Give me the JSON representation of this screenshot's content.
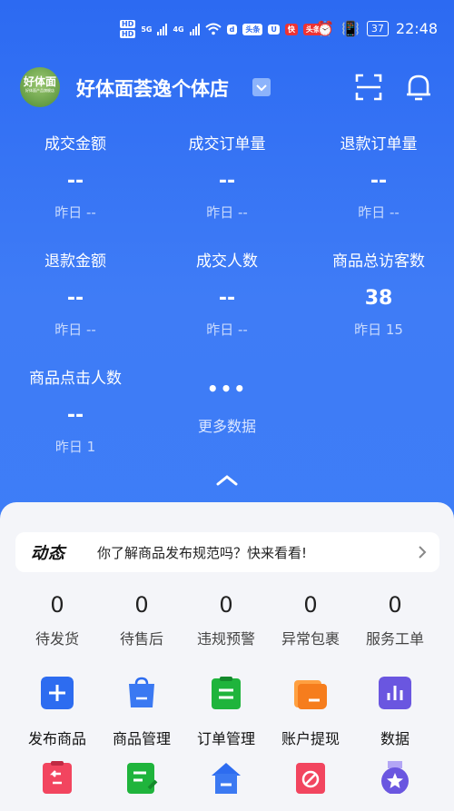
{
  "status_bar": {
    "hd1": "HD",
    "hd2": "HD",
    "net1": "5G",
    "net2": "4G",
    "chip1": "头条",
    "chip2": "头条",
    "battery": "37",
    "time": "22:48"
  },
  "header": {
    "avatar_text": "好体面",
    "avatar_sub": "好体面产品旗舰店",
    "shop_name": "好体面荟逸个体店"
  },
  "stats": [
    {
      "label": "成交金额",
      "value": "--",
      "yesterday": "昨日 --"
    },
    {
      "label": "成交订单量",
      "value": "--",
      "yesterday": "昨日 --"
    },
    {
      "label": "退款订单量",
      "value": "--",
      "yesterday": "昨日 --"
    },
    {
      "label": "退款金额",
      "value": "--",
      "yesterday": "昨日 --"
    },
    {
      "label": "成交人数",
      "value": "--",
      "yesterday": "昨日 --"
    },
    {
      "label": "商品总访客数",
      "value": "38",
      "yesterday": "昨日 15"
    },
    {
      "label": "商品点击人数",
      "value": "--",
      "yesterday": "昨日 1"
    }
  ],
  "more": {
    "dots": "•••",
    "label": "更多数据"
  },
  "notice": {
    "tag": "动态",
    "text": "你了解商品发布规范吗？快来看看!"
  },
  "counters": [
    {
      "value": "0",
      "label": "待发货"
    },
    {
      "value": "0",
      "label": "待售后"
    },
    {
      "value": "0",
      "label": "违规预警"
    },
    {
      "value": "0",
      "label": "异常包裹"
    },
    {
      "value": "0",
      "label": "服务工单"
    }
  ],
  "tools": [
    {
      "label": "发布商品",
      "icon": "plus-icon",
      "color": "#2d6cf0"
    },
    {
      "label": "商品管理",
      "icon": "shopping-bag-icon",
      "color": "#2d6cf0"
    },
    {
      "label": "订单管理",
      "icon": "clipboard-icon",
      "color": "#1fb43c"
    },
    {
      "label": "账户提现",
      "icon": "wallet-icon",
      "color": "#f67d1d"
    },
    {
      "label": "数据",
      "icon": "bar-chart-icon",
      "color": "#6a56e0"
    }
  ],
  "tools_row2": [
    {
      "icon": "return-icon",
      "color": "#f2455f"
    },
    {
      "icon": "edit-note-icon",
      "color": "#1fb43c"
    },
    {
      "icon": "store-icon",
      "color": "#2d6cf0"
    },
    {
      "icon": "block-icon",
      "color": "#f2455f"
    },
    {
      "icon": "star-badge-icon",
      "color": "#6a56e0"
    }
  ]
}
